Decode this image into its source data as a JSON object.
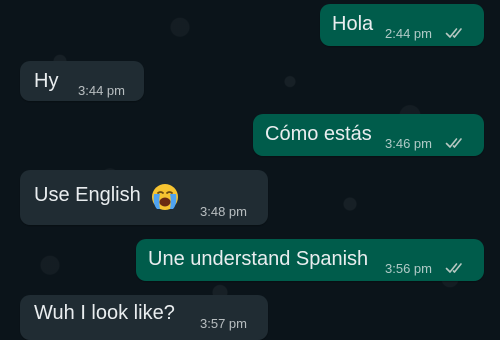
{
  "messages": [
    {
      "direction": "outgoing",
      "text": "Hola",
      "time": "2:44 pm",
      "status_icon": "double-check-icon"
    },
    {
      "direction": "incoming",
      "text": "Hy",
      "time": "3:44 pm"
    },
    {
      "direction": "outgoing",
      "text": "Cómo estás",
      "time": "3:46 pm",
      "status_icon": "double-check-icon"
    },
    {
      "direction": "incoming",
      "text": "Use English",
      "emoji": "loudly-crying-face-icon",
      "time": "3:48 pm"
    },
    {
      "direction": "outgoing",
      "text": "Une understand Spanish",
      "time": "3:56 pm",
      "status_icon": "double-check-icon"
    },
    {
      "direction": "incoming",
      "text": "Wuh I look like?",
      "time": "3:57 pm"
    }
  ],
  "colors": {
    "chat_background": "#0b141a",
    "outgoing_bubble": "#005c4b",
    "incoming_bubble": "#202c33",
    "message_text": "#e9edef",
    "read_ticks": "#b7c8c2"
  }
}
